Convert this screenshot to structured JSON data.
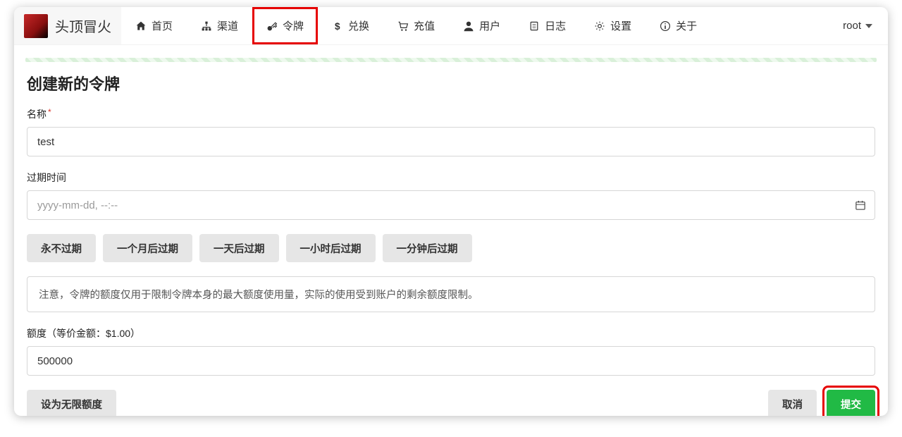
{
  "brand": {
    "title": "头顶冒火"
  },
  "nav": [
    {
      "icon": "home-icon",
      "label": "首页"
    },
    {
      "icon": "sitemap-icon",
      "label": "渠道"
    },
    {
      "icon": "key-icon",
      "label": "令牌",
      "active": true
    },
    {
      "icon": "dollar-icon",
      "label": "兑换"
    },
    {
      "icon": "cart-icon",
      "label": "充值"
    },
    {
      "icon": "user-icon",
      "label": "用户"
    },
    {
      "icon": "book-icon",
      "label": "日志"
    },
    {
      "icon": "gear-icon",
      "label": "设置"
    },
    {
      "icon": "info-icon",
      "label": "关于"
    }
  ],
  "user": {
    "name": "root"
  },
  "page": {
    "title": "创建新的令牌",
    "name_label": "名称",
    "name_value": "test",
    "expire_label": "过期时间",
    "expire_placeholder": "yyyy-mm-dd, --:--",
    "expire_buttons": [
      "永不过期",
      "一个月后过期",
      "一天后过期",
      "一小时后过期",
      "一分钟后过期"
    ],
    "info_text": "注意，令牌的额度仅用于限制令牌本身的最大额度使用量，实际的使用受到账户的剩余额度限制。",
    "quota_label": "额度（等价金额：$1.00）",
    "quota_value": "500000",
    "unlimited_label": "设为无限额度",
    "cancel_label": "取消",
    "submit_label": "提交"
  }
}
